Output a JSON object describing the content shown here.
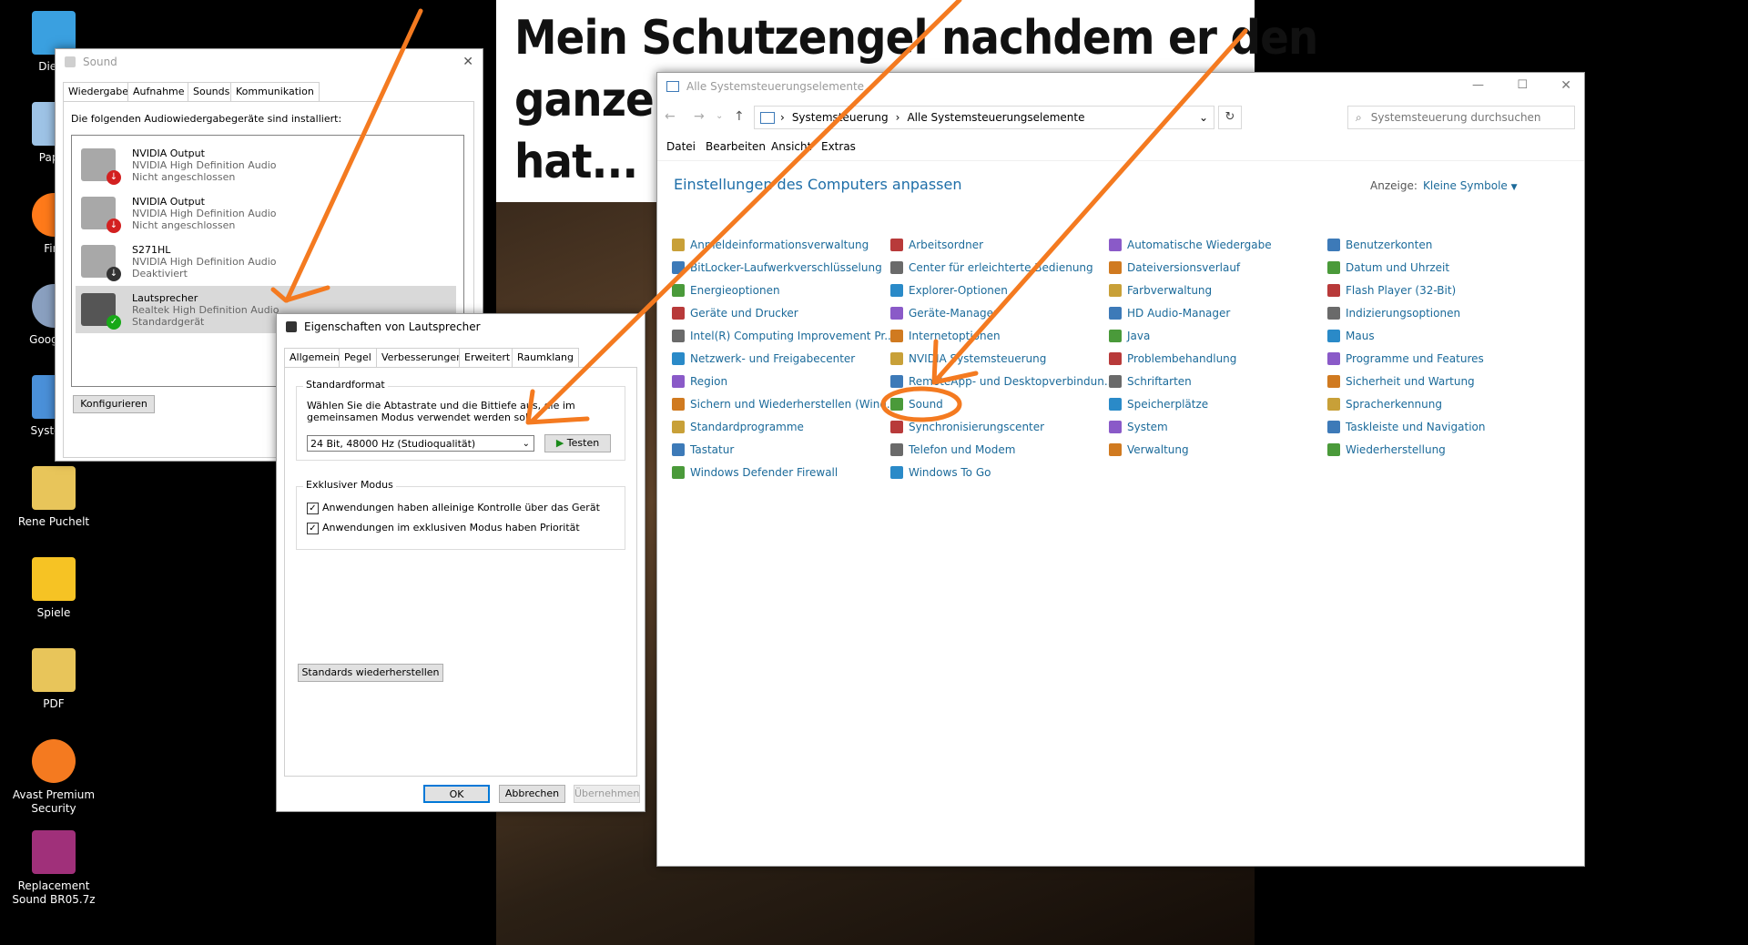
{
  "desktop_icons": [
    {
      "label": "Diese",
      "icon": "computer-icon"
    },
    {
      "label": "Papie",
      "icon": "recycle-bin-icon"
    },
    {
      "label": "Fire",
      "icon": "firefox-icon"
    },
    {
      "label": "Google E",
      "icon": "google-earth-icon"
    },
    {
      "label": "Systems",
      "icon": "control-panel-icon"
    },
    {
      "label": "Rene Puchelt",
      "icon": "user-folder-icon"
    },
    {
      "label": "Spiele",
      "icon": "warning-icon"
    },
    {
      "label": "PDF",
      "icon": "pdf-folder-icon"
    },
    {
      "label": "Avast Premium Security",
      "icon": "avast-icon"
    },
    {
      "label": "Replacement Sound BR05.7z",
      "icon": "archive-icon"
    }
  ],
  "meme": {
    "line1": "Mein Schutzengel nachdem er den",
    "line2": "ganzen",
    "line3": "hat..."
  },
  "sound_dialog": {
    "title": "Sound",
    "tabs": [
      "Wiedergabe",
      "Aufnahme",
      "Sounds",
      "Kommunikation"
    ],
    "active_tab": "Wiedergabe",
    "instructions": "Die folgenden Audiowiedergabegeräte sind installiert:",
    "devices": [
      {
        "name": "NVIDIA Output",
        "driver": "NVIDIA High Definition Audio",
        "status": "Nicht angeschlossen"
      },
      {
        "name": "NVIDIA Output",
        "driver": "NVIDIA High Definition Audio",
        "status": "Nicht angeschlossen"
      },
      {
        "name": "S271HL",
        "driver": "NVIDIA High Definition Audio",
        "status": "Deaktiviert"
      },
      {
        "name": "Lautsprecher",
        "driver": "Realtek High Definition Audio",
        "status": "Standardgerät"
      }
    ],
    "configure_button": "Konfigurieren"
  },
  "props_dialog": {
    "title": "Eigenschaften von Lautsprecher",
    "tabs": [
      "Allgemein",
      "Pegel",
      "Verbesserungen",
      "Erweitert",
      "Raumklang"
    ],
    "active_tab": "Erweitert",
    "default_format_label": "Standardformat",
    "default_format_desc_1": "Wählen Sie die Abtastrate und die Bittiefe aus, die im",
    "default_format_desc_2": "gemeinsamen Modus verwendet werden soll.",
    "format_value": "24 Bit, 48000 Hz (Studioqualität)",
    "test_button": "Testen",
    "exclusive_label": "Exklusiver Modus",
    "exclusive_opt1": "Anwendungen haben alleinige Kontrolle über das Gerät",
    "exclusive_opt2": "Anwendungen im exklusiven Modus haben Priorität",
    "restore_button": "Standards wiederherstellen",
    "ok": "OK",
    "cancel": "Abbrechen",
    "apply": "Übernehmen"
  },
  "control_panel": {
    "title": "Alle Systemsteuerungselemente",
    "breadcrumb": [
      "Systemsteuerung",
      "Alle Systemsteuerungselemente"
    ],
    "search_placeholder": "Systemsteuerung durchsuchen",
    "menu": [
      "Datei",
      "Bearbeiten",
      "Ansicht",
      "Extras"
    ],
    "heading": "Einstellungen des Computers anpassen",
    "view_label": "Anzeige:",
    "view_value": "Kleine Symbole",
    "columns": [
      [
        "Anmeldeinformationsverwaltung",
        "BitLocker-Laufwerkverschlüsselung",
        "Energieoptionen",
        "Geräte und Drucker",
        "Intel(R) Computing Improvement Pr...",
        "Netzwerk- und Freigabecenter",
        "Region",
        "Sichern und Wiederherstellen (Wind...",
        "Standardprogramme",
        "Tastatur",
        "Windows Defender Firewall"
      ],
      [
        "Arbeitsordner",
        "Center für erleichterte Bedienung",
        "Explorer-Optionen",
        "Geräte-Manager",
        "Internetoptionen",
        "NVIDIA Systemsteuerung",
        "RemoteApp- und Desktopverbindun...",
        "Sound",
        "Synchronisierungscenter",
        "Telefon und Modem",
        "Windows To Go"
      ],
      [
        "Automatische Wiedergabe",
        "Dateiversionsverlauf",
        "Farbverwaltung",
        "HD Audio-Manager",
        "Java",
        "Problembehandlung",
        "Schriftarten",
        "Speicherplätze",
        "System",
        "Verwaltung"
      ],
      [
        "Benutzerkonten",
        "Datum und Uhrzeit",
        "Flash Player (32-Bit)",
        "Indizierungsoptionen",
        "Maus",
        "Programme und Features",
        "Sicherheit und Wartung",
        "Spracherkennung",
        "Taskleiste und Navigation",
        "Wiederherstellung"
      ]
    ]
  },
  "colors": {
    "annotation": "#f47a20",
    "link": "#1b6a9a",
    "heading": "#1e6ea8",
    "accent": "#0078d7"
  }
}
